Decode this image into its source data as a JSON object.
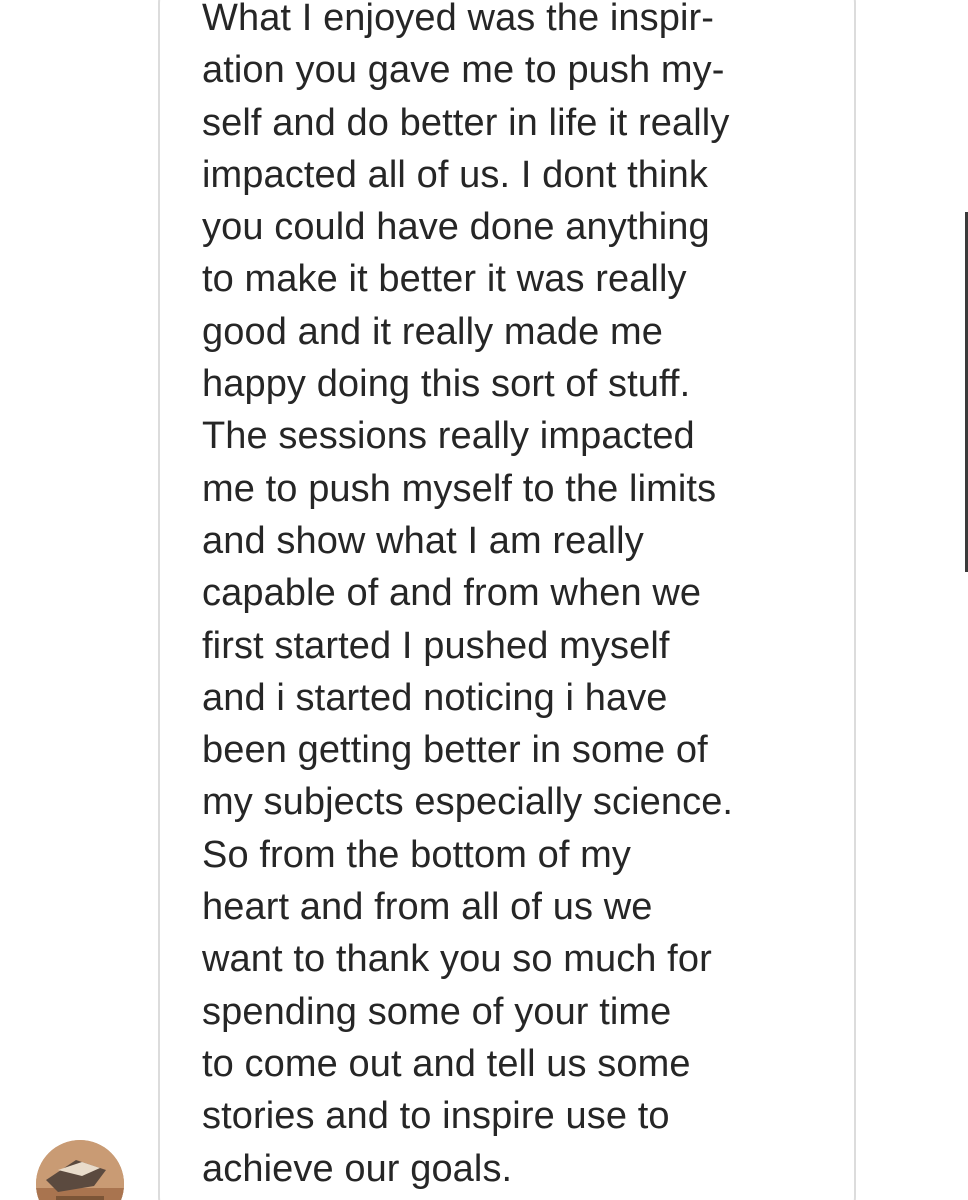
{
  "message": {
    "lines": [
      "What I enjoyed was the inspir-",
      "ation you gave me to push my-",
      "self and do better in life it really",
      "impacted all of us. I dont think",
      "you could have done anything",
      "to make it better it was really",
      "good and it really made me",
      "happy doing this sort of stuff.",
      "The sessions really impacted",
      "me to push myself to the limits",
      "and show what I am really",
      "capable of and from when we",
      "first started I pushed myself",
      "and i started noticing i have",
      "been getting better in some of",
      "my subjects especially science.",
      "So from the bottom of my",
      "heart and from all of us we",
      "want to thank you so much for",
      "spending some of your time",
      "to come out and tell us some",
      "stories and to inspire use to",
      "achieve our goals."
    ]
  },
  "avatar": {
    "icon": "profile-avatar"
  },
  "colors": {
    "bubble_border": "#dcdcdc",
    "text": "#262626",
    "background": "#ffffff"
  }
}
